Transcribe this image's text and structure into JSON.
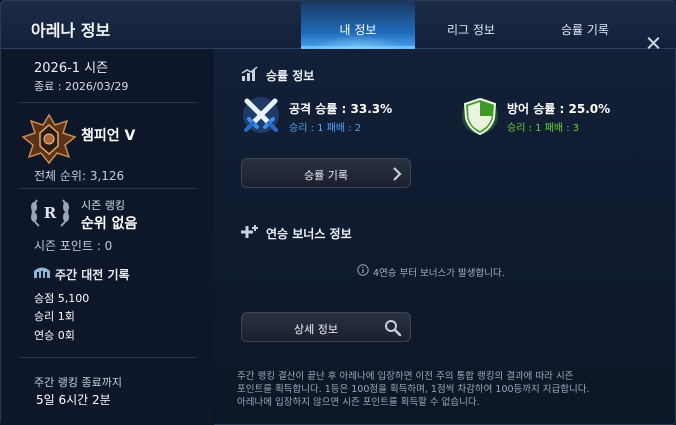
{
  "window": {
    "title": "아레나 정보"
  },
  "tabs": [
    {
      "label": "내 정보",
      "active": true
    },
    {
      "label": "리그 정보",
      "active": false
    },
    {
      "label": "승률 기록",
      "active": false
    }
  ],
  "season": {
    "name": "2026-1 시즌",
    "end": "종료 : 2026/03/29"
  },
  "tier": {
    "name": "챔피언 V",
    "rank": "전체 순위: 3,126",
    "icon": "champion-tier-emblem-icon"
  },
  "season_ranking": {
    "label": "시즌 랭킹",
    "value": "순위 없음",
    "points": "시즌 포인트 : 0",
    "icon": "laurel-rank-badge-icon"
  },
  "weekly": {
    "title": "주간 대전 기록",
    "points": "승점 5,100",
    "wins": "승리 1회",
    "streak": "연승 0회",
    "end_label": "주간 랭킹 종료까지",
    "remaining": "5일 6시간 2분"
  },
  "winrate": {
    "title": "승률 정보",
    "attack": {
      "label": "공격 승률 : 33.3%",
      "detail": "승리 : 1 패배 : 2",
      "color": "#4aa6ff",
      "icon": "crossed-swords-icon"
    },
    "defense": {
      "label": "방어 승률 : 25.0%",
      "detail": "승리 : 1 패배 : 3",
      "color": "#63d43d",
      "icon": "shield-icon"
    }
  },
  "buttons": {
    "history": "승률 기록",
    "detail": "상세 정보"
  },
  "bonus": {
    "title": "연승 보너스 정보",
    "notice": "4연승 부터 보너스가 발생합니다."
  },
  "footer": {
    "lines": [
      "주간 랭킹 결산이 끝난 후 아레나에 입장하면 이전 주의 통합 랭킹의 결과에 따라 시즌",
      "포인트를 획득합니다. 1등은 100점을 획득하며, 1점씩 차감하여 100등까지 지급합니다.",
      "아레나에 입장하지 않으면 시즌 포인트를 획득할 수 없습니다."
    ]
  }
}
